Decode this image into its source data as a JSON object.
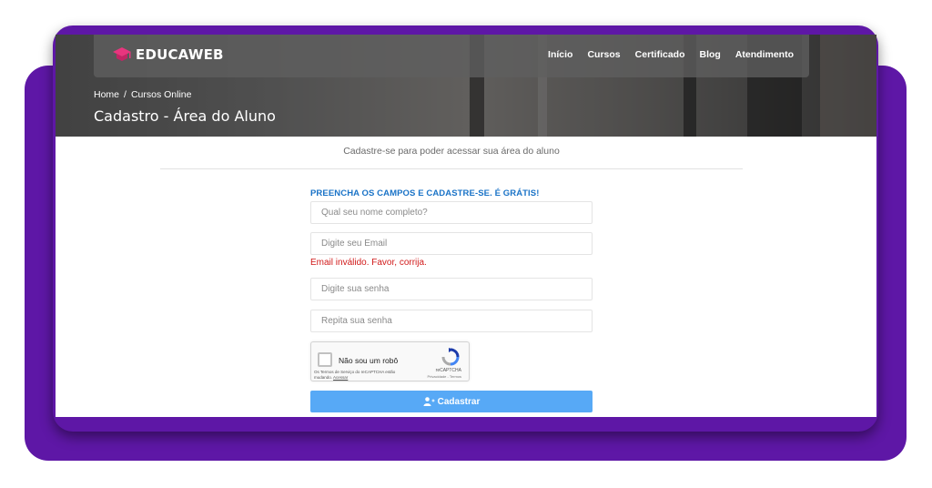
{
  "brand": {
    "name": "EDUCAWEB",
    "color": "#e8357e"
  },
  "nav": {
    "items": [
      {
        "label": "Início"
      },
      {
        "label": "Cursos"
      },
      {
        "label": "Certificado"
      },
      {
        "label": "Blog"
      },
      {
        "label": "Atendimento"
      }
    ]
  },
  "breadcrumb": {
    "home": "Home",
    "separator": "/",
    "current": "Cursos Online"
  },
  "page": {
    "title": "Cadastro - Área do Aluno",
    "subtitle": "Cadastre-se para poder acessar sua área do aluno"
  },
  "form": {
    "heading": "PREENCHA OS CAMPOS E CADASTRE-SE. É GRÁTIS!",
    "name_placeholder": "Qual seu nome completo?",
    "email_placeholder": "Digite seu Email",
    "email_error": "Email inválido. Favor, corrija.",
    "password_placeholder": "Digite sua senha",
    "password_repeat_placeholder": "Repita sua senha",
    "submit_label": "Cadastrar",
    "submit_icon": "user-plus-icon"
  },
  "recaptcha": {
    "label": "Não sou um robô",
    "terms_text": "Os Termos de Serviço do reCAPTCHA estão mudando.",
    "terms_link": "Acessar",
    "brand": "reCAPTCHA",
    "privacy": "Privacidade - Termos"
  },
  "colors": {
    "frame": "#5e17a6",
    "accent": "#57a9f6",
    "heading": "#1a73c7",
    "error": "#d11a1a"
  }
}
